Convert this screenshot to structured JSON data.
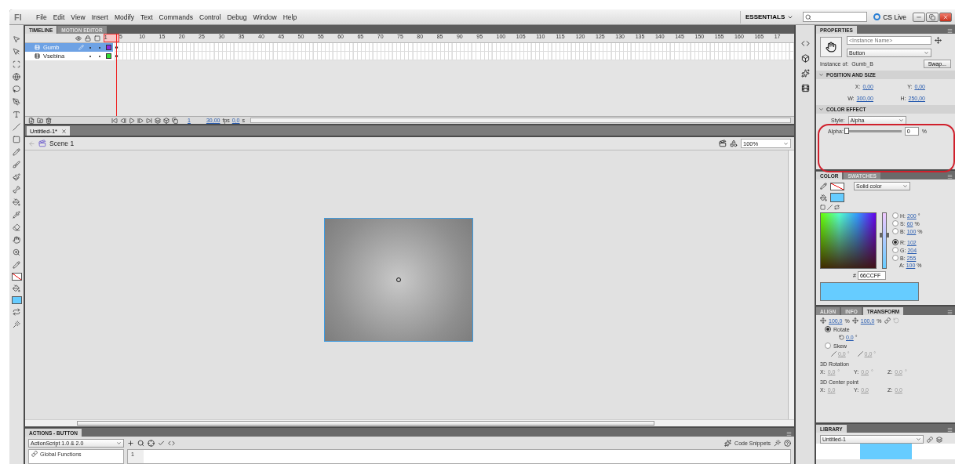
{
  "app": {
    "logo": "Fl",
    "menu": [
      "File",
      "Edit",
      "View",
      "Insert",
      "Modify",
      "Text",
      "Commands",
      "Control",
      "Debug",
      "Window",
      "Help"
    ],
    "workspace": "ESSENTIALS",
    "cs_live": "CS Live"
  },
  "timeline": {
    "tabs": [
      {
        "label": "TIMELINE",
        "selected": true
      },
      {
        "label": "MOTION EDITOR",
        "selected": false
      }
    ],
    "frame_numbers": [
      "1",
      "5",
      "10",
      "15",
      "20",
      "25",
      "30",
      "35",
      "40",
      "45",
      "50",
      "55",
      "60",
      "65",
      "70",
      "75",
      "80",
      "85",
      "90",
      "95",
      "100",
      "105",
      "110",
      "115",
      "120",
      "125",
      "130",
      "135",
      "140",
      "145",
      "150",
      "155",
      "160",
      "165",
      "17"
    ],
    "layers": [
      {
        "name": "Gumb",
        "selected": true,
        "color": "#8a2be2"
      },
      {
        "name": "Vsebina",
        "selected": false,
        "color": "#33dd33"
      }
    ],
    "current_frame": "1",
    "fps": "30,00",
    "fps_unit": "fps",
    "time": "0,0",
    "time_unit": "s"
  },
  "document": {
    "tabs": [
      {
        "label": "Untitled-1*",
        "selected": true
      }
    ],
    "scene": "Scene 1",
    "zoom": "100%"
  },
  "properties": {
    "title": "PROPERTIES",
    "instance_name": {
      "placeholder": "<Instance Name>"
    },
    "symbol_type": "Button",
    "instance_of_label": "Instance of:",
    "instance_of": "Gumb_B",
    "swap": "Swap...",
    "position_and_size": {
      "title": "POSITION AND SIZE",
      "fields": [
        {
          "label": "X:",
          "value": "0,00"
        },
        {
          "label": "Y:",
          "value": "0,00"
        },
        {
          "label": "W:",
          "value": "300,00"
        },
        {
          "label": "H:",
          "value": "250,00"
        }
      ]
    },
    "color_effect": {
      "title": "COLOR EFFECT",
      "style_label": "Style:",
      "style": "Alpha",
      "alpha_label": "Alpha:",
      "alpha": {
        "level": 0
      },
      "alpha_value": "0",
      "alpha_unit": "%"
    }
  },
  "color": {
    "tabs": [
      {
        "label": "COLOR",
        "selected": true
      },
      {
        "label": "SWATCHES",
        "selected": false
      }
    ],
    "fill_type": "Solid color",
    "channels": [
      {
        "label": "H:",
        "value": "200",
        "unit": "°",
        "selected": false
      },
      {
        "label": "S:",
        "value": "60",
        "unit": "%",
        "selected": false
      },
      {
        "label": "B:",
        "value": "100",
        "unit": "%",
        "selected": false
      },
      {
        "label": "R:",
        "value": "102",
        "selected": true
      },
      {
        "label": "G:",
        "value": "204",
        "selected": false
      },
      {
        "label": "B:",
        "value": "255",
        "selected": false
      }
    ],
    "hue_slider": {
      "level": 0.6
    },
    "alpha_channel": {
      "label": "A:",
      "value": "100",
      "unit": "%"
    },
    "hex_label": "#",
    "hex": "66CCFF"
  },
  "transform": {
    "tabs": [
      {
        "label": "ALIGN",
        "selected": false
      },
      {
        "label": "INFO",
        "selected": false
      },
      {
        "label": "TRANSFORM",
        "selected": true
      }
    ],
    "width_scale": "100,0",
    "height_scale": "100,0",
    "scale_unit_1": "%",
    "scale_unit_2": "%",
    "modes": [
      {
        "label": "Rotate",
        "selected": true
      },
      {
        "label": "Skew",
        "selected": false
      }
    ],
    "rotate": {
      "value": "0,0",
      "unit": "°"
    },
    "skew": [
      {
        "value": "0,0",
        "unit": "°"
      },
      {
        "value": "0,0",
        "unit": "°"
      }
    ],
    "rotation_3d": {
      "title": "3D Rotation",
      "fields": [
        {
          "label": "X:",
          "value": "0,0",
          "unit": "°"
        },
        {
          "label": "Y:",
          "value": "0,0",
          "unit": "°"
        },
        {
          "label": "Z:",
          "value": "0,0",
          "unit": "°"
        }
      ]
    },
    "center_3d": {
      "title": "3D Center point",
      "fields": [
        {
          "label": "X:",
          "value": "0,0"
        },
        {
          "label": "Y:",
          "value": "0,0"
        },
        {
          "label": "Z:",
          "value": "0,0"
        }
      ]
    }
  },
  "library": {
    "title": "LIBRARY",
    "document": "Untitled-1"
  },
  "actions": {
    "title": "ACTIONS - BUTTON",
    "version": "ActionScript 1.0 & 2.0",
    "tree": [
      {
        "label": "Global Functions"
      }
    ],
    "code_snippets": "Code Snippets",
    "line_numbers": [
      "1"
    ]
  }
}
